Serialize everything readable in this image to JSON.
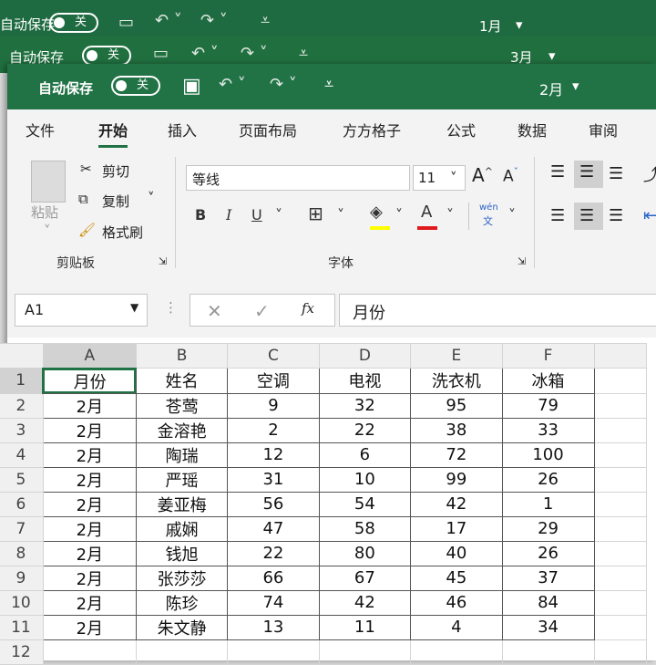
{
  "windows_behind": [
    {
      "autosave": "自动保存",
      "toggle": "关",
      "title": "1月"
    },
    {
      "autosave": "自动保存",
      "toggle": "关",
      "title": "3月"
    }
  ],
  "window": {
    "autosave": "自动保存",
    "toggle": "关",
    "title": "2月"
  },
  "tabs": [
    "文件",
    "开始",
    "插入",
    "页面布局",
    "方方格子",
    "公式",
    "数据",
    "审阅"
  ],
  "active_tab": "开始",
  "clipboard": {
    "paste": "粘贴",
    "cut": "剪切",
    "copy": "复制",
    "format_painter": "格式刷",
    "group": "剪贴板"
  },
  "font": {
    "name": "等线",
    "size": "11",
    "group": "字体",
    "bold": "B",
    "italic": "I",
    "underline": "U",
    "phonetic": "wén",
    "phonetic_sub": "文",
    "grow": "A",
    "shrink": "A",
    "font_color": "A"
  },
  "formula": {
    "name_box": "A1",
    "fx": "fx",
    "value": "月份"
  },
  "colors": {
    "excel_green": "#217346",
    "highlight": "#ffff00",
    "font_color": "#e0191f"
  },
  "columns": [
    "A",
    "B",
    "C",
    "D",
    "E",
    "F"
  ],
  "rows": [
    [
      "月份",
      "姓名",
      "空调",
      "电视",
      "洗衣机",
      "冰箱"
    ],
    [
      "2月",
      "苍莺",
      "9",
      "32",
      "95",
      "79"
    ],
    [
      "2月",
      "金溶艳",
      "2",
      "22",
      "38",
      "33"
    ],
    [
      "2月",
      "陶瑞",
      "12",
      "6",
      "72",
      "100"
    ],
    [
      "2月",
      "严瑶",
      "31",
      "10",
      "99",
      "26"
    ],
    [
      "2月",
      "姜亚梅",
      "56",
      "54",
      "42",
      "1"
    ],
    [
      "2月",
      "戚娴",
      "47",
      "58",
      "17",
      "29"
    ],
    [
      "2月",
      "钱旭",
      "22",
      "80",
      "40",
      "26"
    ],
    [
      "2月",
      "张莎莎",
      "66",
      "67",
      "45",
      "37"
    ],
    [
      "2月",
      "陈珍",
      "74",
      "42",
      "46",
      "84"
    ],
    [
      "2月",
      "朱文静",
      "13",
      "11",
      "4",
      "34"
    ]
  ],
  "row_numbers": [
    "1",
    "2",
    "3",
    "4",
    "5",
    "6",
    "7",
    "8",
    "9",
    "10",
    "11",
    "12"
  ]
}
